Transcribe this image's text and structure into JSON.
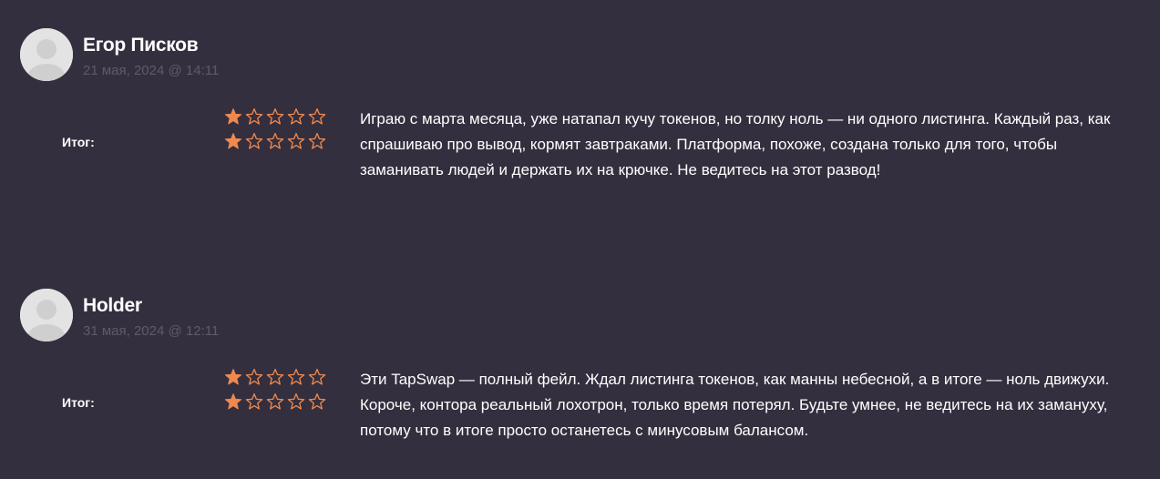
{
  "reviews": [
    {
      "author": "Егор Писков",
      "date": "21 мая, 2024 @ 14:11",
      "total_label": "Итог:",
      "rating_rows": [
        1,
        1
      ],
      "max_rating": 5,
      "text": "Играю с марта месяца, уже натапал кучу токенов, но толку ноль — ни одного листинга. Каждый раз, как спрашиваю про вывод, кормят завтраками. Платформа, похоже, создана только для того, чтобы заманивать людей и держать их на крючке. Не ведитесь на этот развод!"
    },
    {
      "author": "Holder",
      "date": "31 мая, 2024 @ 12:11",
      "total_label": "Итог:",
      "rating_rows": [
        1,
        1
      ],
      "max_rating": 5,
      "text": "Эти TapSwap — полный фейл. Ждал листинга токенов, как манны небесной, а в итоге — ноль движухи. Короче, контора реальный лохотрон, только время потерял. Будьте умнее, не ведитесь на их замануху, потому что в итоге просто останетесь с минусовым балансом."
    }
  ],
  "colors": {
    "background": "#342f3e",
    "star": "#f0894e",
    "date": "#5f5a6a",
    "text": "#ffffff"
  },
  "icons": {
    "avatar": "default-user-avatar-icon",
    "star_filled": "star-filled-icon",
    "star_empty": "star-outline-icon"
  }
}
